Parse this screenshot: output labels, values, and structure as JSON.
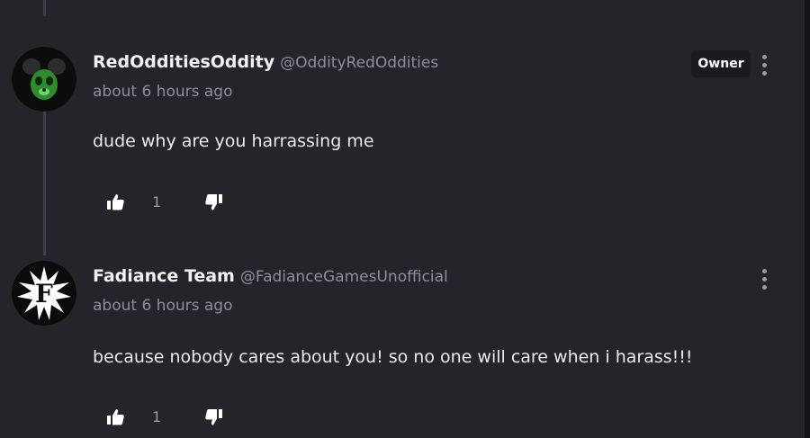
{
  "colors": {
    "background": "#25242b",
    "thread_line": "#3f3e46",
    "text_primary": "#f2f2f4",
    "text_secondary": "#8f8e96",
    "badge_bg": "#1a1a1f"
  },
  "comments": [
    {
      "author_name": "RedOdditiesOddity",
      "author_handle": "@OddityRedOddities",
      "timestamp": "about 6 hours ago",
      "body": "dude why are you harrassing me",
      "badge": "Owner",
      "avatar_icon": "green-mouse-avatar-icon",
      "like_icon": "thumbs-up-icon",
      "like_count": "1",
      "dislike_icon": "thumbs-down-icon",
      "menu_icon": "more-vertical-icon"
    },
    {
      "author_name": "Fadiance Team",
      "author_handle": "@FadianceGamesUnofficial",
      "timestamp": "about 6 hours ago",
      "body": "because nobody cares about you! so no one will care when i harass!!!",
      "avatar_icon": "f-starburst-logo-icon",
      "avatar_letter": "F",
      "like_icon": "thumbs-up-icon",
      "like_count": "1",
      "dislike_icon": "thumbs-down-icon",
      "menu_icon": "more-vertical-icon"
    }
  ]
}
